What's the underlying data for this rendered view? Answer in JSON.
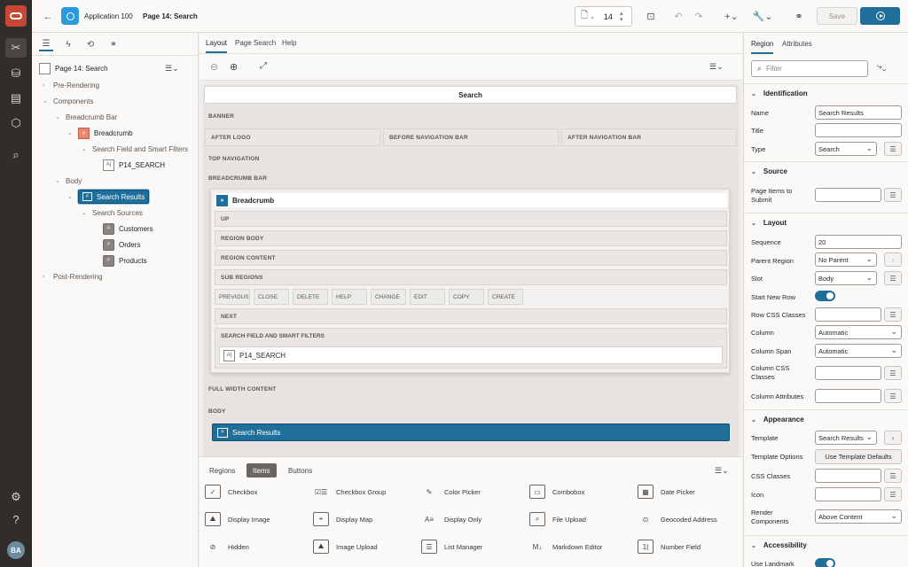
{
  "header": {
    "app_name": "Application 100",
    "page_title": "Page 14: Search",
    "page_number": "14",
    "save_label": "Save"
  },
  "rail": {
    "avatar": "BA"
  },
  "left_panel": {
    "root": "Page 14: Search",
    "tree": [
      {
        "label": "Pre-Rendering"
      },
      {
        "label": "Components"
      },
      {
        "label": "Breadcrumb Bar"
      },
      {
        "label": "Breadcrumb"
      },
      {
        "label": "Search Field and Smart Filters"
      },
      {
        "label": "P14_SEARCH"
      },
      {
        "label": "Body"
      },
      {
        "label": "Search Results"
      },
      {
        "label": "Search Sources"
      },
      {
        "label": "Customers"
      },
      {
        "label": "Orders"
      },
      {
        "label": "Products"
      },
      {
        "label": "Post-Rendering"
      }
    ]
  },
  "center": {
    "tabs": [
      "Layout",
      "Page Search",
      "Help"
    ],
    "search_bar": "Search",
    "slots": {
      "banner": "BANNER",
      "after_logo": "AFTER LOGO",
      "before_nav": "BEFORE NAVIGATION BAR",
      "after_nav": "AFTER NAVIGATION BAR",
      "top_nav": "TOP NAVIGATION",
      "breadcrumb_bar": "BREADCRUMB BAR",
      "full_width": "FULL WIDTH CONTENT",
      "body": "BODY"
    },
    "breadcrumb": {
      "title": "Breadcrumb",
      "up": "UP",
      "region_body": "REGION BODY",
      "region_content": "REGION CONTENT",
      "sub_regions": "SUB REGIONS",
      "buttons": [
        "PREVIOUS",
        "CLOSE",
        "DELETE",
        "HELP",
        "CHANGE",
        "EDIT",
        "COPY",
        "CREATE"
      ],
      "next": "NEXT",
      "search_field_slot": "SEARCH FIELD AND SMART FILTERS",
      "search_item": "P14_SEARCH"
    },
    "body_region": "Search Results",
    "palette": {
      "tabs": [
        "Regions",
        "Items",
        "Buttons"
      ],
      "items": [
        {
          "label": "Checkbox",
          "icon": "checkbox-icon"
        },
        {
          "label": "Checkbox Group",
          "icon": "checkbox-group-icon"
        },
        {
          "label": "Color Picker",
          "icon": "color-picker-icon"
        },
        {
          "label": "Combobox",
          "icon": "combobox-icon"
        },
        {
          "label": "Date Picker",
          "icon": "date-picker-icon"
        },
        {
          "label": "Display Image",
          "icon": "display-image-icon"
        },
        {
          "label": "Display Map",
          "icon": "display-map-icon"
        },
        {
          "label": "Display Only",
          "icon": "display-only-icon"
        },
        {
          "label": "File Upload",
          "icon": "file-upload-icon"
        },
        {
          "label": "Geocoded Address",
          "icon": "geocoded-address-icon"
        },
        {
          "label": "Hidden",
          "icon": "hidden-icon"
        },
        {
          "label": "Image Upload",
          "icon": "image-upload-icon"
        },
        {
          "label": "List Manager",
          "icon": "list-manager-icon"
        },
        {
          "label": "Markdown Editor",
          "icon": "markdown-editor-icon"
        },
        {
          "label": "Number Field",
          "icon": "number-field-icon"
        }
      ]
    }
  },
  "right_panel": {
    "tabs": [
      "Region",
      "Attributes"
    ],
    "filter_placeholder": "Filter",
    "sections": {
      "identification": "Identification",
      "source": "Source",
      "layout": "Layout",
      "appearance": "Appearance",
      "accessibility": "Accessibility"
    },
    "props": {
      "name_label": "Name",
      "name_value": "Search Results",
      "title_label": "Title",
      "title_value": "",
      "type_label": "Type",
      "type_value": "Search",
      "page_items_label": "Page Items to Submit",
      "page_items_value": "",
      "sequence_label": "Sequence",
      "sequence_value": "20",
      "parent_label": "Parent Region",
      "parent_value": "No Parent",
      "slot_label": "Slot",
      "slot_value": "Body",
      "start_new_row_label": "Start New Row",
      "row_css_label": "Row CSS Classes",
      "row_css_value": "",
      "column_label": "Column",
      "column_value": "Automatic",
      "column_span_label": "Column Span",
      "column_span_value": "Automatic",
      "column_css_label": "Column CSS Classes",
      "column_css_value": "",
      "column_attr_label": "Column Attributes",
      "column_attr_value": "",
      "template_label": "Template",
      "template_value": "Search Results",
      "template_options_label": "Template Options",
      "template_options_button": "Use Template Defaults",
      "css_classes_label": "CSS Classes",
      "css_classes_value": "",
      "icon_label": "Icon",
      "icon_value": "",
      "render_label": "Render Components",
      "render_value": "Above Content",
      "use_landmark_label": "Use Landmark"
    }
  }
}
